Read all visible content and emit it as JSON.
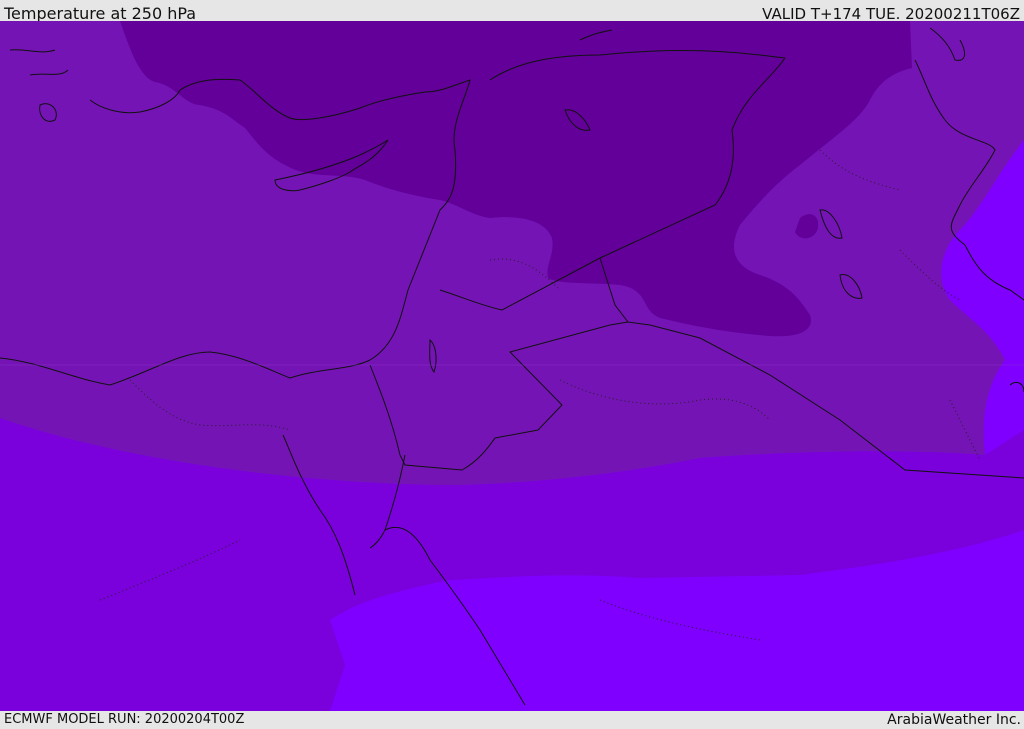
{
  "header": {
    "title": "Temperature at 250 hPa",
    "valid": "VALID T+174 TUE. 20200211T06Z"
  },
  "footer": {
    "model_run": "ECMWF MODEL RUN: 20200204T00Z",
    "credit": "ArabiaWeather Inc."
  },
  "map": {
    "field_colors": [
      "#620099",
      "#7514b5",
      "#7a00dc",
      "#7f00ff"
    ]
  }
}
